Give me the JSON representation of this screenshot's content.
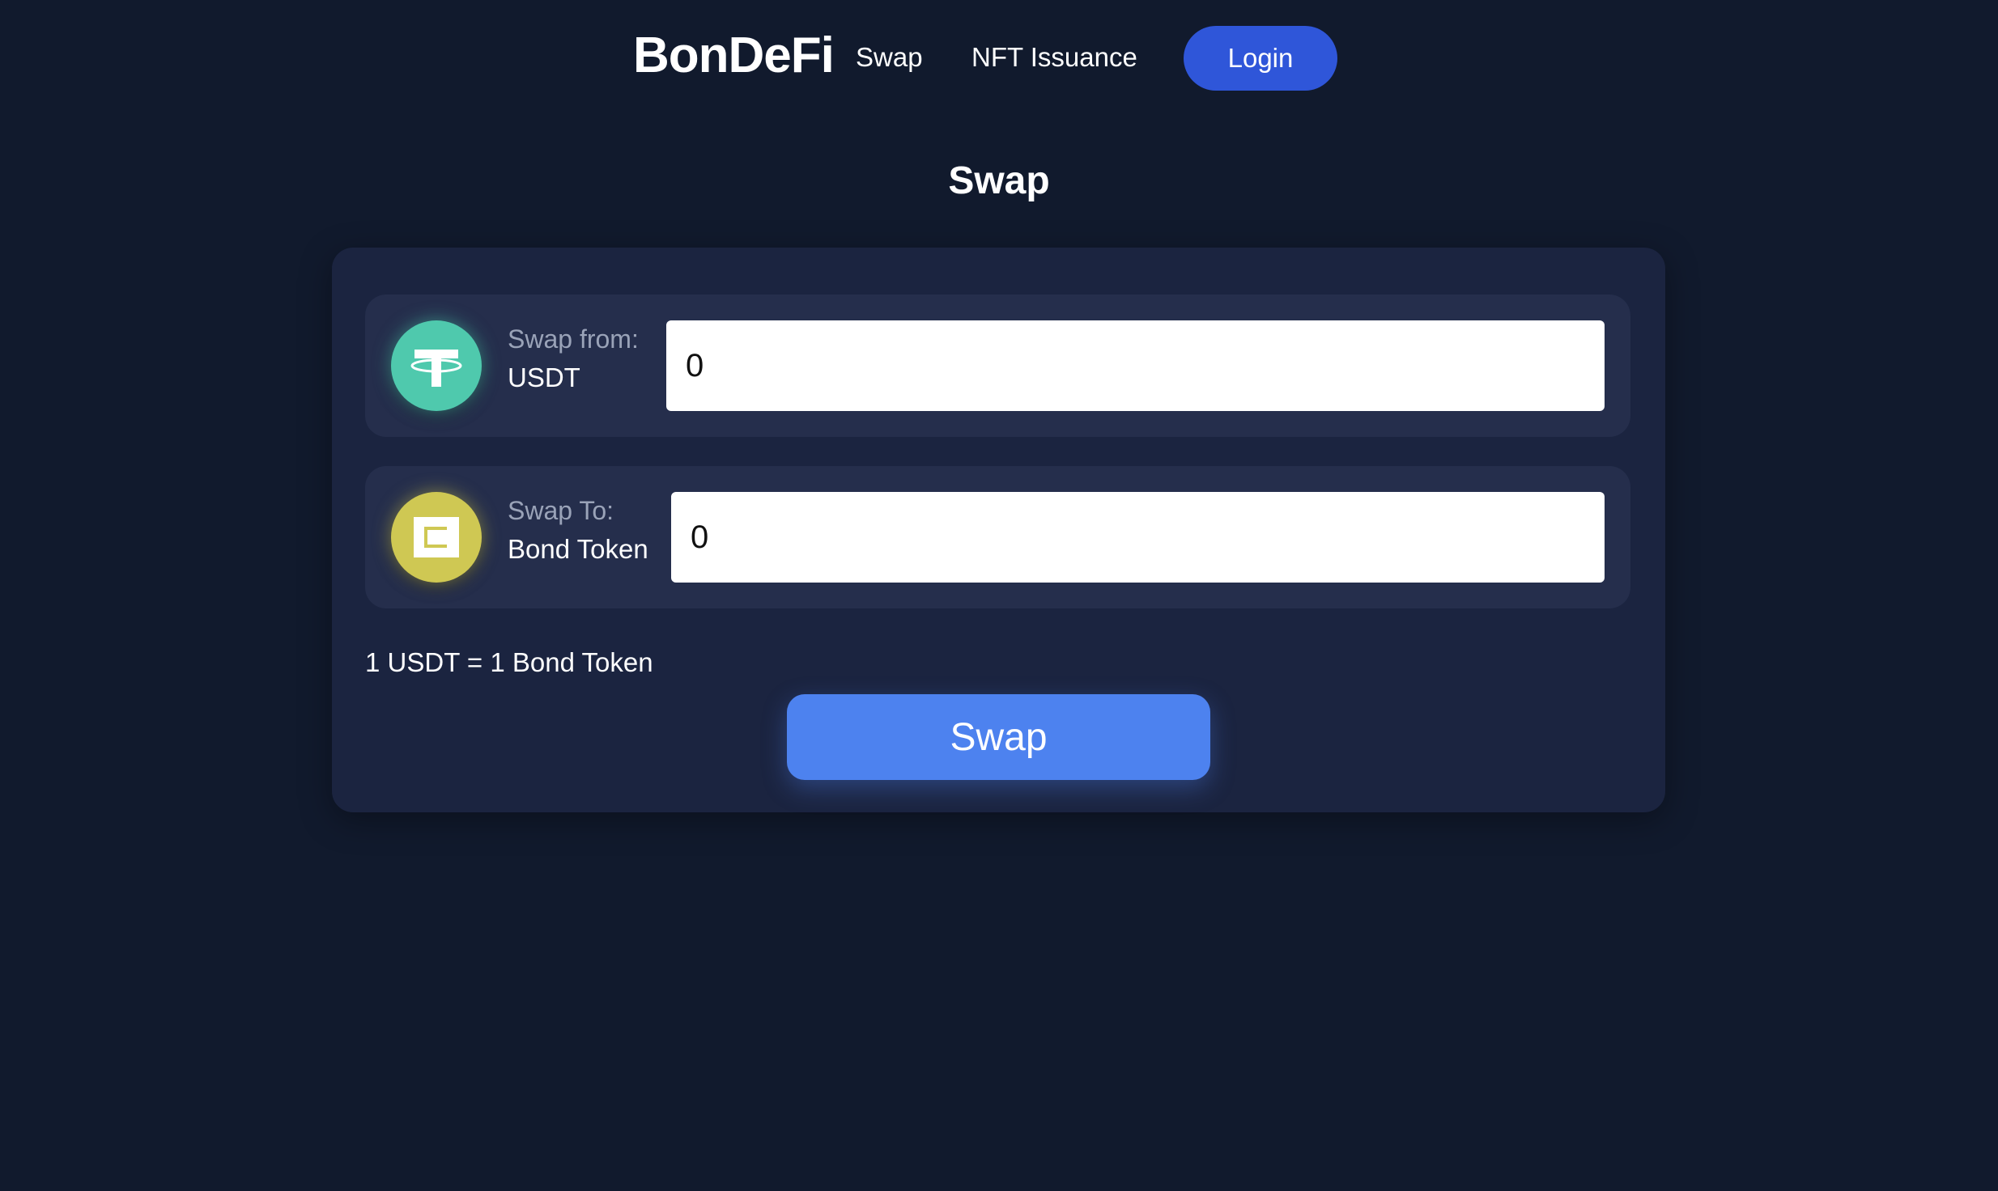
{
  "header": {
    "brand": "BonDeFi",
    "nav": {
      "swap": "Swap",
      "nft_issuance": "NFT Issuance"
    },
    "login_label": "Login"
  },
  "page": {
    "title": "Swap"
  },
  "swap_from": {
    "caption": "Swap from:",
    "token": "USDT",
    "icon": "tether-icon",
    "value": "0"
  },
  "swap_to": {
    "caption": "Swap To:",
    "token": "Bond Token",
    "icon": "bond-token-icon",
    "value": "0"
  },
  "rate": "1 USDT = 1 Bond Token",
  "swap_button_label": "Swap",
  "colors": {
    "background": "#111a2d",
    "card": "#1b2440",
    "row": "#252e4c",
    "login_button": "#2f56d9",
    "swap_button": "#4d82ef",
    "usdt_icon": "#4fc9ad",
    "bond_icon": "#cfc853"
  }
}
